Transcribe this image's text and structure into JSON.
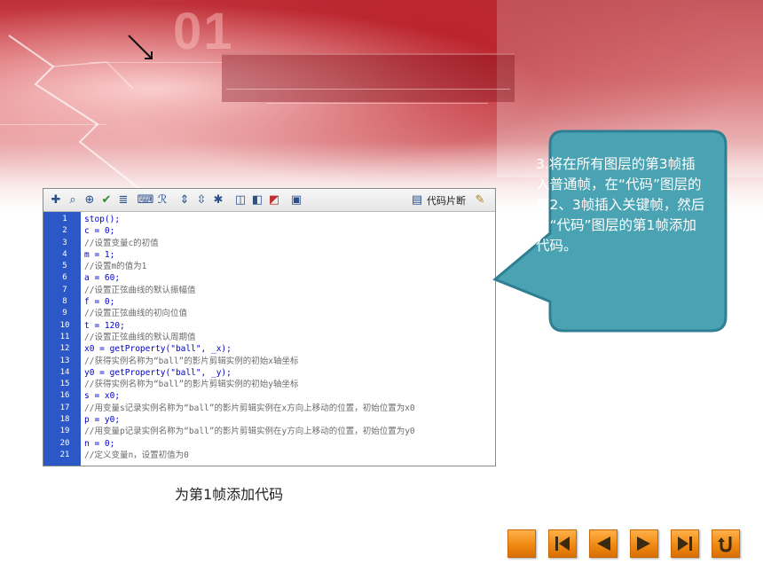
{
  "banner": {
    "number": "01"
  },
  "toolbar": {
    "icons": [
      "add-statement-icon",
      "find-icon",
      "target-icon",
      "check-syntax-icon",
      "auto-format-icon",
      "show-hint-icon",
      "debug-options-icon",
      "collapse-braces-icon",
      "collapse-selection-icon",
      "expand-all-icon",
      "apply-block-comment-icon",
      "apply-line-comment-icon",
      "remove-comment-icon",
      "show-hide-toolbox-icon"
    ],
    "snippets_label": "代码片断"
  },
  "code": {
    "line_numbers": [
      "1",
      "2",
      "3",
      "4",
      "5",
      "6",
      "7",
      "8",
      "9",
      "10",
      "11",
      "12",
      "13",
      "14",
      "15",
      "16",
      "17",
      "18",
      "19",
      "20",
      "21"
    ],
    "lines": [
      {
        "text": "stop();",
        "type": "code"
      },
      {
        "text": "c = 0;",
        "type": "code"
      },
      {
        "text": "//设置变量c的初值",
        "type": "comment"
      },
      {
        "text": "m = 1;",
        "type": "code"
      },
      {
        "text": "//设置m的值为1",
        "type": "comment"
      },
      {
        "text": "a = 60;",
        "type": "code"
      },
      {
        "text": "//设置正弦曲线的默认振幅值",
        "type": "comment"
      },
      {
        "text": "f = 0;",
        "type": "code"
      },
      {
        "text": "//设置正弦曲线的初向位值",
        "type": "comment"
      },
      {
        "text": "t = 120;",
        "type": "code"
      },
      {
        "text": "//设置正弦曲线的默认周期值",
        "type": "comment"
      },
      {
        "text": "x0 = getProperty(\"ball\", _x);",
        "type": "code"
      },
      {
        "text": "//获得实例名称为“ball”的影片剪辑实例的初始x轴坐标",
        "type": "comment"
      },
      {
        "text": "y0 = getProperty(\"ball\", _y);",
        "type": "code"
      },
      {
        "text": "//获得实例名称为“ball”的影片剪辑实例的初始y轴坐标",
        "type": "comment"
      },
      {
        "text": "s = x0;",
        "type": "code"
      },
      {
        "text": "//用变量s记录实例名称为“ball”的影片剪辑实例在x方向上移动的位置，初始位置为x0",
        "type": "comment"
      },
      {
        "text": "p = y0;",
        "type": "code"
      },
      {
        "text": "//用变量p记录实例名称为“ball”的影片剪辑实例在y方向上移动的位置，初始位置为y0",
        "type": "comment"
      },
      {
        "text": "n = 0;",
        "type": "code"
      },
      {
        "text": "//定义变量n，设置初值为0",
        "type": "comment"
      }
    ]
  },
  "caption": "为第1帧添加代码",
  "callout": {
    "text": "3.将在所有图层的第3帧插入普通帧，在“代码”图层的第2、3帧插入关键帧，然后为“代码”图层的第1帧添加代码。",
    "fill_color": "#4aa3b3",
    "border_color": "#2f7f93"
  },
  "nav": {
    "buttons": [
      {
        "name": "home-button",
        "icon": "square-icon"
      },
      {
        "name": "first-button",
        "icon": "first-page-icon"
      },
      {
        "name": "prev-button",
        "icon": "previous-icon"
      },
      {
        "name": "next-button",
        "icon": "next-icon"
      },
      {
        "name": "last-button",
        "icon": "last-page-icon"
      },
      {
        "name": "return-button",
        "icon": "return-icon"
      }
    ],
    "accent_color": "#f08a12"
  }
}
